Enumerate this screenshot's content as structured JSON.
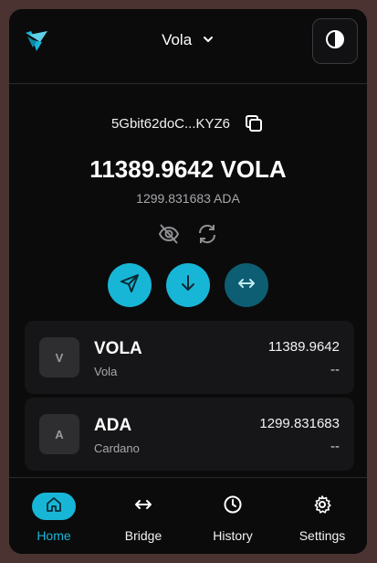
{
  "header": {
    "network_label": "Vola",
    "logo_icon": "vola-logo-icon",
    "theme_icon": "contrast-icon"
  },
  "wallet": {
    "address": "5Gbit62doC...KYZ6",
    "balance": "11389.9642 VOLA",
    "secondary_balance": "1299.831683 ADA"
  },
  "tools": {
    "hide_icon": "eye-off-icon",
    "refresh_icon": "refresh-icon"
  },
  "actions": [
    {
      "icon": "send-icon"
    },
    {
      "icon": "receive-icon"
    },
    {
      "icon": "bridge-arrows-icon"
    }
  ],
  "tokens": [
    {
      "badge": "V",
      "symbol": "VOLA",
      "name": "Vola",
      "amount": "11389.9642",
      "fiat": "--"
    },
    {
      "badge": "A",
      "symbol": "ADA",
      "name": "Cardano",
      "amount": "1299.831683",
      "fiat": "--"
    }
  ],
  "nav": [
    {
      "label": "Home",
      "icon": "home-icon",
      "active": true
    },
    {
      "label": "Bridge",
      "icon": "bridge-icon",
      "active": false
    },
    {
      "label": "History",
      "icon": "clock-icon",
      "active": false
    },
    {
      "label": "Settings",
      "icon": "gear-icon",
      "active": false
    }
  ],
  "colors": {
    "accent": "#18b6d6",
    "accent_dark": "#0d5e72",
    "background": "#0b0b0c",
    "card": "#161618",
    "outer": "#4a3330"
  }
}
